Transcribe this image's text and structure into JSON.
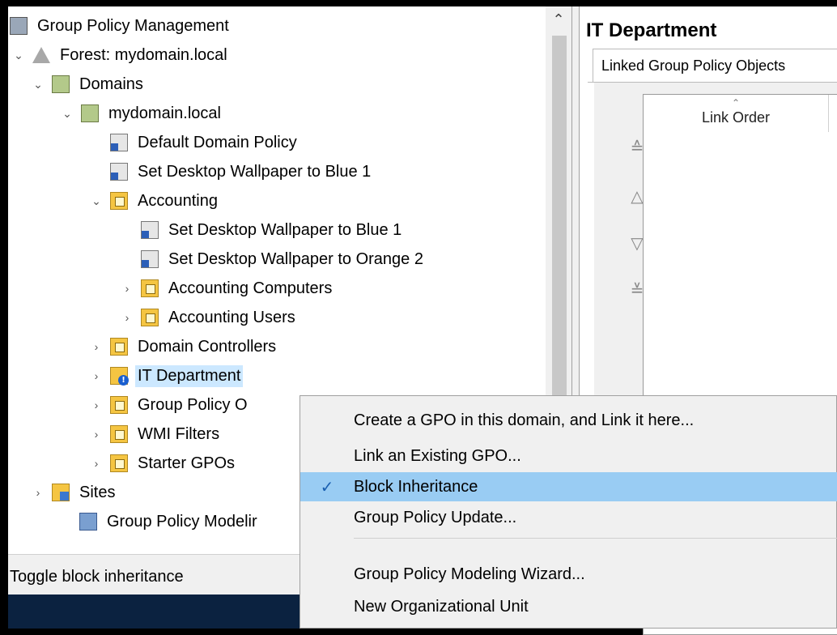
{
  "tree": {
    "root_label": "Group Policy Management",
    "forest_label": "Forest: mydomain.local",
    "domains_label": "Domains",
    "domain_label": "mydomain.local",
    "default_domain_policy": "Default Domain Policy",
    "gpo_blue_1": "Set Desktop Wallpaper to Blue 1",
    "accounting": "Accounting",
    "acc_gpo_blue": "Set Desktop Wallpaper to Blue 1",
    "acc_gpo_orange": "Set Desktop Wallpaper to Orange 2",
    "acc_computers": "Accounting Computers",
    "acc_users": "Accounting Users",
    "domain_controllers": "Domain Controllers",
    "it_department": "IT Department",
    "gp_objects": "Group Policy O",
    "wmi_filters": "WMI Filters",
    "starter_gpos": "Starter GPOs",
    "sites": "Sites",
    "gp_modeling": "Group Policy Modelir"
  },
  "status_text": "Toggle block inheritance",
  "right_pane": {
    "title": "IT Department",
    "tab_label": "Linked Group Policy Objects",
    "column_header": "Link Order"
  },
  "context_menu": {
    "items": [
      "Create a GPO in this domain, and Link it here...",
      "Link an Existing GPO...",
      "Block Inheritance",
      "Group Policy Update...",
      "Group Policy Modeling Wizard...",
      "New Organizational Unit"
    ],
    "checked_item": "Block Inheritance"
  },
  "colors": {
    "highlight": "#99ccf3",
    "selected_tree": "#cce8ff",
    "menu_bg": "#f0f0f0"
  }
}
